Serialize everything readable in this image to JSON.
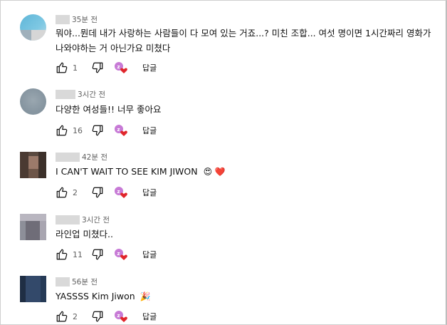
{
  "comments": [
    {
      "time": "35분 전",
      "text": "뭐야...뭔데 내가 사랑하는 사람들이 다 모여 있는 거죠...? 미친 조합... 여섯 명이면 1시간짜리 영화가 나와야하는 거 아닌가요 미쳤다",
      "likes": "1",
      "reply": "답글"
    },
    {
      "time": "3시간 전",
      "text": "다양한 여성들!! 너무 좋아요",
      "likes": "16",
      "reply": "답글"
    },
    {
      "time": "42분 전",
      "text": "I CAN'T WAIT TO SEE KIM JIWON",
      "text_emoji": "😍 ❤️",
      "likes": "2",
      "reply": "답글"
    },
    {
      "time": "3시간 전",
      "text": "라인업 미쳤다..",
      "likes": "11",
      "reply": "답글"
    },
    {
      "time": "56분 전",
      "text": "YASSSS Kim Jiwon",
      "text_emoji": "🎉",
      "likes": "2",
      "reply": "답글"
    }
  ],
  "icons": {
    "like": "thumbs-up-icon",
    "dislike": "thumbs-down-icon",
    "creator_heart": "creator-heart-icon"
  },
  "colors": {
    "heart": "#e0262c",
    "creator_avatar": "#c77ad6",
    "secondary_text": "#606060"
  }
}
